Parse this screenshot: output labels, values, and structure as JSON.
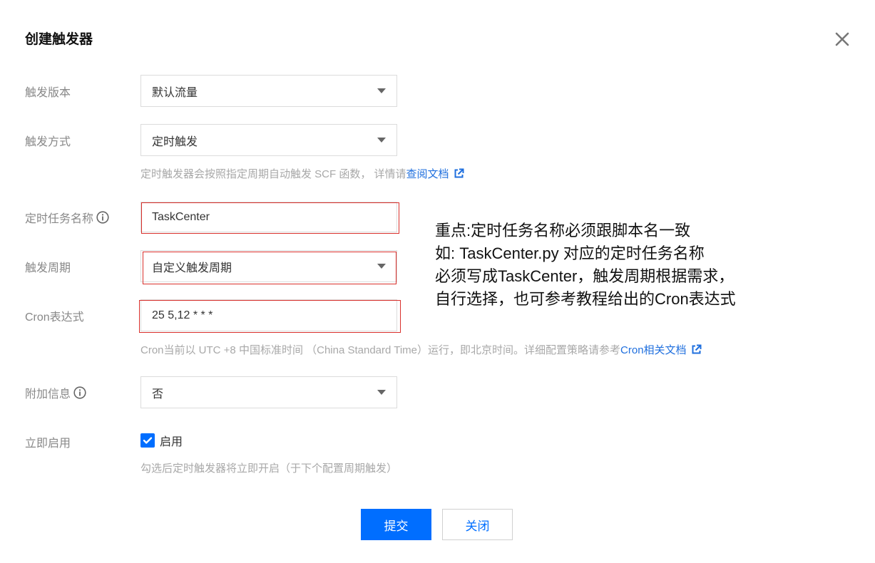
{
  "dialog": {
    "title": "创建触发器"
  },
  "form": {
    "version": {
      "label": "触发版本",
      "value": "默认流量"
    },
    "method": {
      "label": "触发方式",
      "value": "定时触发",
      "help_text": "定时触发器会按照指定周期自动触发 SCF 函数， 详情请",
      "help_link": "查阅文档"
    },
    "task_name": {
      "label": "定时任务名称",
      "value": "TaskCenter"
    },
    "period": {
      "label": "触发周期",
      "value": "自定义触发周期"
    },
    "cron": {
      "label": "Cron表达式",
      "value": "25 5,12 * * *",
      "help_text": "Cron当前以 UTC +8 中国标准时间 （China Standard Time）运行，即北京时间。详细配置策略请参考",
      "help_link": "Cron相关文档"
    },
    "extra_info": {
      "label": "附加信息",
      "value": "否"
    },
    "enable": {
      "label": "立即启用",
      "checkbox_label": "启用",
      "checked": true,
      "help_text": "勾选后定时触发器将立即开启（于下个配置周期触发）"
    }
  },
  "annotation": {
    "lines": [
      "重点:定时任务名称必须跟脚本名一致",
      "如: TaskCenter.py 对应的定时任务名称",
      "必须写成TaskCenter，触发周期根据需求，",
      "自行选择，也可参考教程给出的Cron表达式"
    ]
  },
  "footer": {
    "submit_label": "提交",
    "close_label": "关闭"
  },
  "colors": {
    "primary": "#006eff",
    "link": "#1f6fde",
    "highlight": "#d9302c"
  },
  "icons": {
    "close": "close-icon",
    "info": "info-icon",
    "external_link": "external-link-icon",
    "dropdown": "chevron-down-icon",
    "check": "check-icon"
  }
}
